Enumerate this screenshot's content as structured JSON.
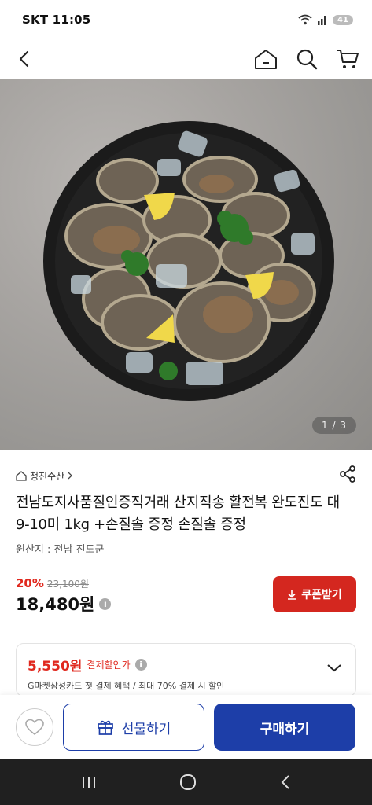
{
  "status_bar": {
    "carrier_time": "SKT 11:05",
    "battery": "41"
  },
  "nav": {
    "icons": [
      "back-icon",
      "home-icon",
      "search-icon",
      "cart-icon"
    ]
  },
  "hero": {
    "counter": "1 / 3"
  },
  "product": {
    "store_name": "청진수산",
    "title": "전남도지사품질인증직거래 산지직송 활전복 완도진도 대 9-10미 1kg +손질솔 증정 손질솔 증정",
    "origin": "원산지 : 전남 진도군",
    "discount": "20%",
    "original_price": "23,100원",
    "final_price": "18,480원",
    "coupon_button": "쿠폰받기"
  },
  "card_offer": {
    "price": "5,550원",
    "label": "결제할인가",
    "description": "G마켓삼성카드 첫 결제 혜택 / 최대 70% 결제 시 할인"
  },
  "bottom_bar": {
    "gift_label": "선물하기",
    "buy_label": "구매하기"
  },
  "colors": {
    "accent_red": "#d4271f",
    "brand_blue": "#1d3ea8"
  }
}
